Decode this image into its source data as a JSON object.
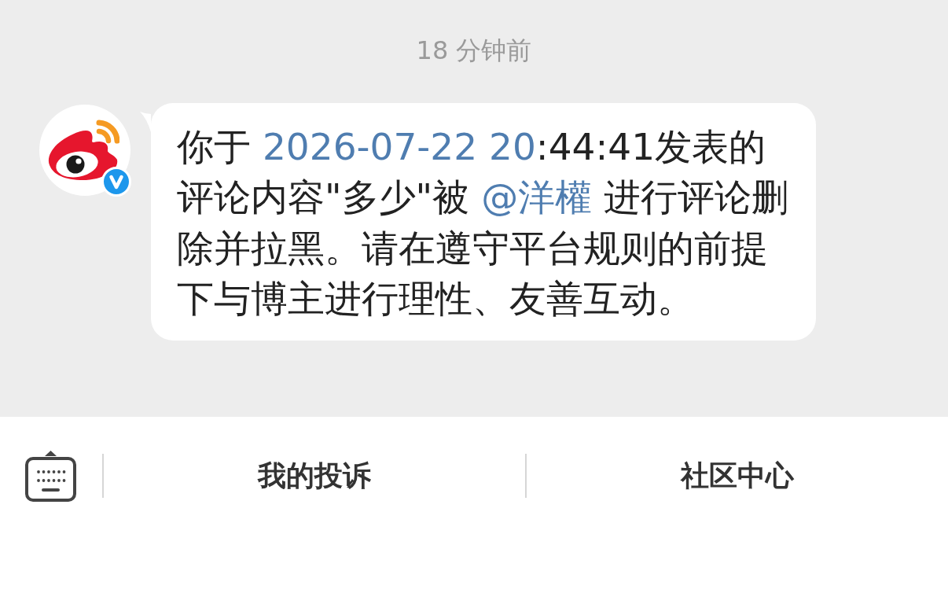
{
  "timestamp": "18 分钟前",
  "message": {
    "sender": {
      "verified": true
    },
    "parts": [
      {
        "kind": "text",
        "text": "你于 "
      },
      {
        "kind": "link",
        "text": "2026-07-22 20"
      },
      {
        "kind": "text",
        "text": ":44:41发表的评论内容\"多少\"被 "
      },
      {
        "kind": "link",
        "text": "@洋權"
      },
      {
        "kind": "text",
        "text": " 进行评论删除并拉黑。请在遵守平台规则的前提下与博主进行理性、友善互动。"
      }
    ]
  },
  "bottom_bar": {
    "buttons": [
      {
        "label": "我的投诉"
      },
      {
        "label": "社区中心"
      }
    ]
  }
}
